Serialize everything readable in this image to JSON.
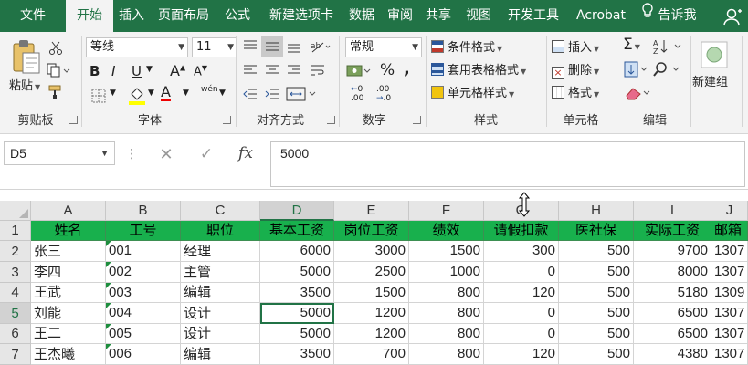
{
  "tabs": [
    "文件",
    "开始",
    "插入",
    "页面布局",
    "公式",
    "新建选项卡",
    "数据",
    "审阅",
    "共享",
    "视图",
    "开发工具",
    "Acrobat"
  ],
  "active_tab": "开始",
  "tell_me": "告诉我",
  "clipboard": {
    "paste": "粘贴",
    "label": "剪贴板"
  },
  "font": {
    "name": "等线",
    "size": "11",
    "label": "字体",
    "bold": "B",
    "italic": "I",
    "underline": "U",
    "grow": "A",
    "shrink": "A",
    "phonetic": "wén",
    "font_color_letter": "A"
  },
  "alignment": {
    "label": "对齐方式"
  },
  "number": {
    "format": "常规",
    "label": "数字",
    "percent": "%",
    "comma": ",",
    "decimal_inc": ".00",
    "decimal_dec": ".00"
  },
  "styles": {
    "conditional": "条件格式",
    "table": "套用表格格式",
    "cell": "单元格样式",
    "label": "样式"
  },
  "cells": {
    "insert": "插入",
    "delete": "删除",
    "format": "格式",
    "label": "单元格"
  },
  "editing": {
    "label": "编辑",
    "sigma": "Σ"
  },
  "newgroup": {
    "label": "新建组"
  },
  "formula_bar": {
    "name_box": "D5",
    "fx": "fx",
    "value": "5000"
  },
  "columns": [
    "A",
    "B",
    "C",
    "D",
    "E",
    "F",
    "G",
    "H",
    "I",
    "J"
  ],
  "rows": [
    "1",
    "2",
    "3",
    "4",
    "5",
    "6",
    "7"
  ],
  "selected_column": "D",
  "selected_row": "5",
  "headers": [
    "姓名",
    "工号",
    "职位",
    "基本工资",
    "岗位工资",
    "绩效",
    "请假扣款",
    "医社保",
    "实际工资",
    "邮箱"
  ],
  "records": [
    [
      "张三",
      "001",
      "经理",
      "6000",
      "3000",
      "1500",
      "300",
      "500",
      "9700",
      "1307"
    ],
    [
      "李四",
      "002",
      "主管",
      "5000",
      "2500",
      "1000",
      "0",
      "500",
      "8000",
      "1307"
    ],
    [
      "王武",
      "003",
      "编辑",
      "3500",
      "1500",
      "800",
      "120",
      "500",
      "5180",
      "1309"
    ],
    [
      "刘能",
      "004",
      "设计",
      "5000",
      "1200",
      "800",
      "0",
      "500",
      "6500",
      "1307"
    ],
    [
      "王二",
      "005",
      "设计",
      "5000",
      "1200",
      "800",
      "0",
      "500",
      "6500",
      "1307"
    ],
    [
      "王杰曦",
      "006",
      "编辑",
      "3500",
      "700",
      "800",
      "120",
      "500",
      "4380",
      "1307"
    ]
  ],
  "colors": {
    "brand": "#217346",
    "header_fill": "#18b04d",
    "error_triangle": "#1e8e3e"
  }
}
